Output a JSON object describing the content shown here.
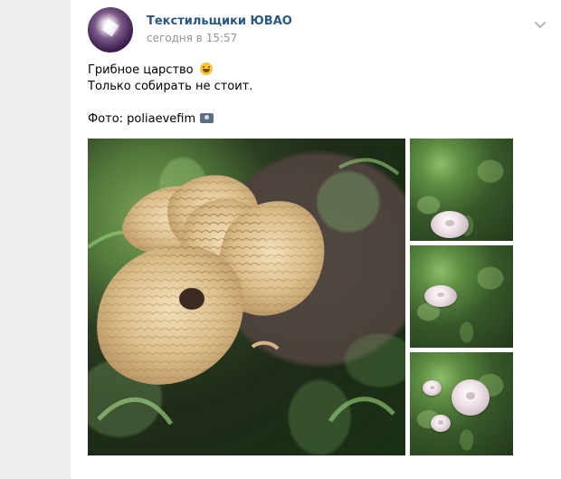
{
  "post": {
    "author": "Текстильщики ЮВАО",
    "time": "сегодня в 15:57",
    "text": {
      "line1": "Грибное царство",
      "line2": "Только собирать не стоит.",
      "line3": "Фото: poliaevefim"
    }
  },
  "icons": {
    "more": "chevron-down-icon",
    "emoji1": "grinning-face-emoji-icon",
    "emoji2": "camera-emoji-icon"
  },
  "colors": {
    "link": "#2a5885",
    "muted": "#939393",
    "background": "#edeef0"
  }
}
